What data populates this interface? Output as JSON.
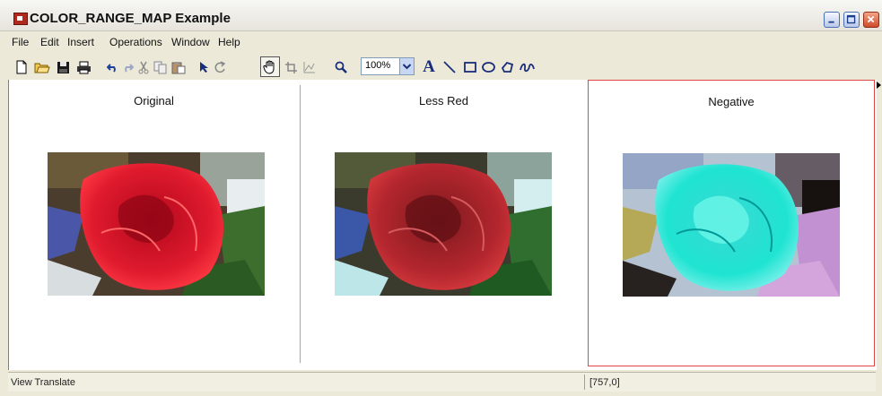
{
  "window": {
    "title": "COLOR_RANGE_MAP Example"
  },
  "menubar": [
    "File",
    "Edit",
    "Insert",
    "Operations",
    "Window",
    "Help"
  ],
  "toolbar": {
    "zoom": "100%",
    "icons": [
      "new-document-icon",
      "open-folder-icon",
      "save-icon",
      "print-icon",
      "undo-icon",
      "redo-icon",
      "cut-icon",
      "copy-icon",
      "paste-icon",
      "select-arrow-icon",
      "rotate-icon",
      "pan-hand-icon",
      "crop-icon",
      "line-profile-icon",
      "zoom-magnifier-icon",
      "text-icon",
      "line-icon",
      "rectangle-icon",
      "ellipse-icon",
      "polygon-icon",
      "freehand-icon"
    ]
  },
  "panels": [
    {
      "title": "Original",
      "image": "rose-original"
    },
    {
      "title": "Less Red",
      "image": "rose-less-red"
    },
    {
      "title": "Negative",
      "image": "rose-negative",
      "selected": true
    }
  ],
  "status": {
    "left": "View Translate",
    "right": "[757,0]"
  },
  "colors": {
    "selection_border": "#e14545",
    "chrome": "#ece9d8",
    "close_button": "#cf4a2b"
  }
}
